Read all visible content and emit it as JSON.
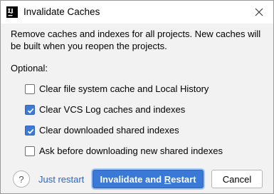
{
  "window": {
    "title": "Invalidate Caches",
    "icon": "intellij-app-icon"
  },
  "dialog": {
    "description": "Remove caches and indexes for all projects. New caches will be built when you reopen the projects.",
    "optional_label": "Optional:",
    "options": [
      {
        "label": "Clear file system cache and Local History",
        "checked": false
      },
      {
        "label": "Clear VCS Log caches and indexes",
        "checked": true
      },
      {
        "label": "Clear downloaded shared indexes",
        "checked": true
      },
      {
        "label": "Ask before downloading new shared indexes",
        "checked": false
      }
    ]
  },
  "footer": {
    "help_label": "?",
    "just_restart_label": "Just restart",
    "primary_label_part1": "Invalidate and ",
    "primary_label_mnemonic": "R",
    "primary_label_part2": "estart",
    "cancel_label": "Cancel"
  },
  "colors": {
    "accent": "#3a79d6",
    "link": "#2a64c8",
    "background": "#f2f2f2"
  }
}
